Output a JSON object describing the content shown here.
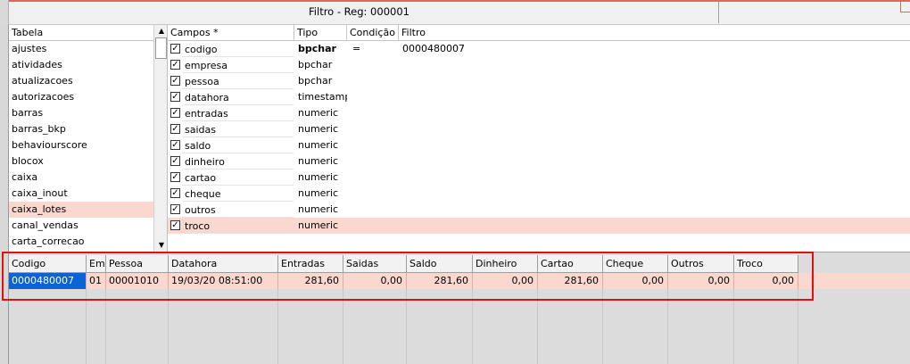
{
  "window": {
    "title": "Filtro - Reg: 000001"
  },
  "tabela": {
    "header": "Tabela",
    "items": [
      "ajustes",
      "atividades",
      "atualizacoes",
      "autorizacoes",
      "barras",
      "barras_bkp",
      "behaviourscore",
      "blocox",
      "caixa",
      "caixa_inout",
      "caixa_lotes",
      "canal_vendas",
      "carta_correcao"
    ],
    "selected_index": 10
  },
  "campos": {
    "headers": {
      "campos": "Campos *",
      "tipo": "Tipo",
      "condicao": "Condição",
      "filtro": "Filtro"
    },
    "rows": [
      {
        "campo": "codigo",
        "tipo": "bpchar",
        "condicao": "=",
        "filtro": "0000480007",
        "checked": true,
        "bold": true
      },
      {
        "campo": "empresa",
        "tipo": "bpchar",
        "condicao": "",
        "filtro": "",
        "checked": true
      },
      {
        "campo": "pessoa",
        "tipo": "bpchar",
        "condicao": "",
        "filtro": "",
        "checked": true
      },
      {
        "campo": "datahora",
        "tipo": "timestamp",
        "condicao": "",
        "filtro": "",
        "checked": true
      },
      {
        "campo": "entradas",
        "tipo": "numeric",
        "condicao": "",
        "filtro": "",
        "checked": true
      },
      {
        "campo": "saidas",
        "tipo": "numeric",
        "condicao": "",
        "filtro": "",
        "checked": true
      },
      {
        "campo": "saldo",
        "tipo": "numeric",
        "condicao": "",
        "filtro": "",
        "checked": true
      },
      {
        "campo": "dinheiro",
        "tipo": "numeric",
        "condicao": "",
        "filtro": "",
        "checked": true
      },
      {
        "campo": "cartao",
        "tipo": "numeric",
        "condicao": "",
        "filtro": "",
        "checked": true
      },
      {
        "campo": "cheque",
        "tipo": "numeric",
        "condicao": "",
        "filtro": "",
        "checked": true
      },
      {
        "campo": "outros",
        "tipo": "numeric",
        "condicao": "",
        "filtro": "",
        "checked": true
      },
      {
        "campo": "troco",
        "tipo": "numeric",
        "condicao": "",
        "filtro": "",
        "checked": true
      }
    ],
    "selected_index": 11
  },
  "results": {
    "columns": [
      "Codigo",
      "Emp",
      "Pessoa",
      "Datahora",
      "Entradas",
      "Saidas",
      "Saldo",
      "Dinheiro",
      "Cartao",
      "Cheque",
      "Outros",
      "Troco"
    ],
    "row": [
      "0000480007",
      "01",
      "00001010",
      "19/03/20 08:51:00",
      "281,60",
      "0,00",
      "281,60",
      "0,00",
      "281,60",
      "0,00",
      "0,00",
      "0,00"
    ]
  },
  "colors": {
    "selection_row": "#fbd8cf",
    "focus_cell": "#0a64d8",
    "highlight_box": "#e01010"
  },
  "icons": {
    "checkbox": "checkmark-icon",
    "scroll_up": "up-arrow-icon",
    "scroll_down": "down-arrow-icon"
  }
}
